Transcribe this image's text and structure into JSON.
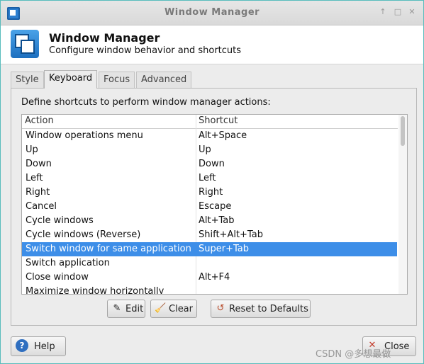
{
  "window": {
    "title": "Window Manager",
    "maximize_icon": "maximize-icon",
    "close_icon": "close-icon"
  },
  "header": {
    "title": "Window Manager",
    "subtitle": "Configure window behavior and shortcuts"
  },
  "tabs": [
    {
      "label": "Style",
      "active": false
    },
    {
      "label": "Keyboard",
      "active": true
    },
    {
      "label": "Focus",
      "active": false
    },
    {
      "label": "Advanced",
      "active": false
    }
  ],
  "keyboard": {
    "instructions": "Define shortcuts to perform window manager actions:",
    "columns": {
      "action": "Action",
      "shortcut": "Shortcut"
    },
    "rows": [
      {
        "action": "Window operations menu",
        "shortcut": "Alt+Space"
      },
      {
        "action": "Up",
        "shortcut": "Up"
      },
      {
        "action": "Down",
        "shortcut": "Down"
      },
      {
        "action": "Left",
        "shortcut": "Left"
      },
      {
        "action": "Right",
        "shortcut": "Right"
      },
      {
        "action": "Cancel",
        "shortcut": "Escape"
      },
      {
        "action": "Cycle windows",
        "shortcut": "Alt+Tab"
      },
      {
        "action": "Cycle windows (Reverse)",
        "shortcut": "Shift+Alt+Tab"
      },
      {
        "action": "Switch window for same application",
        "shortcut": "Super+Tab",
        "selected": true
      },
      {
        "action": "Switch application",
        "shortcut": ""
      },
      {
        "action": "Close window",
        "shortcut": "Alt+F4"
      },
      {
        "action": "Maximize window horizontally",
        "shortcut": ""
      }
    ],
    "buttons": {
      "edit": "Edit",
      "clear": "Clear",
      "reset": "Reset to Defaults"
    }
  },
  "footer": {
    "help": "Help",
    "close": "Close"
  },
  "watermark": "CSDN @多想最做"
}
